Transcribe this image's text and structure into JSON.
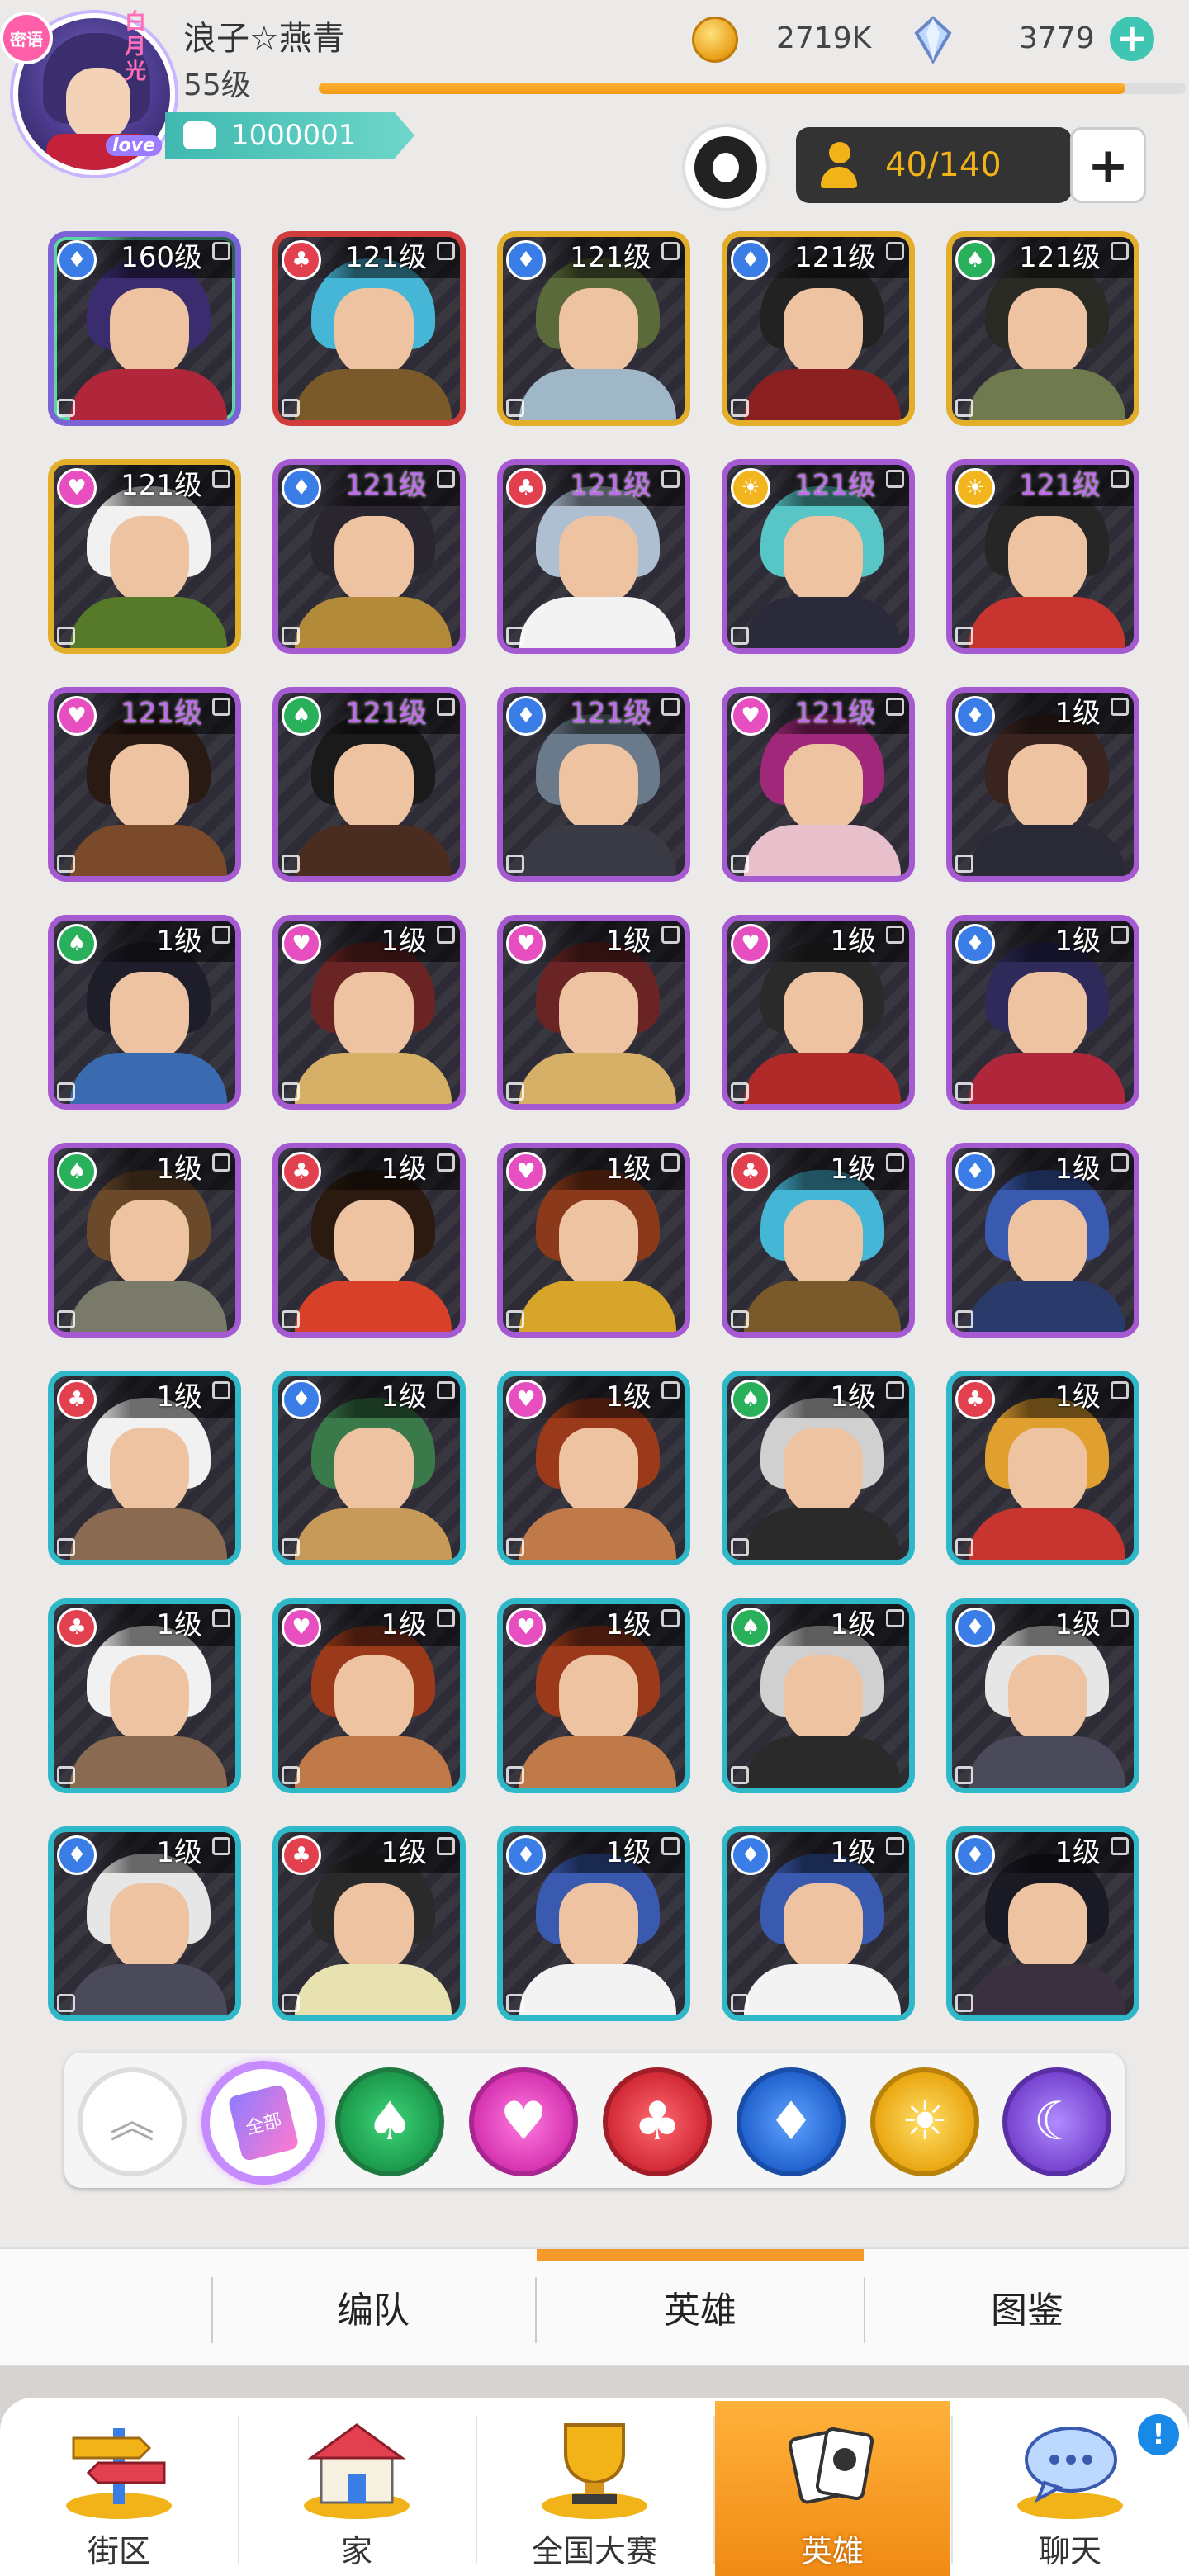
{
  "player": {
    "name": "浪子☆燕青",
    "level": "55级",
    "power": "1000001",
    "xp_fraction": 0.93,
    "avatar_badge": "密语",
    "avatar_deco": "白月光",
    "avatar_love": "love"
  },
  "currency": {
    "gold": "2719K",
    "gems": "3779"
  },
  "roster": {
    "count": "40/140"
  },
  "heroes": [
    {
      "level": "160级",
      "suit": "diamond",
      "quality": "rainbow",
      "hair": "#3a2c6e",
      "body": "#b0263a"
    },
    {
      "level": "121级",
      "suit": "club",
      "quality": "red",
      "hair": "#46b6d6",
      "body": "#7a5a2a"
    },
    {
      "level": "121级",
      "suit": "diamond",
      "quality": "gold",
      "hair": "#5b6a3a",
      "body": "#9fb7c6"
    },
    {
      "level": "121级",
      "suit": "diamond",
      "quality": "gold",
      "hair": "#222222",
      "body": "#8a2020"
    },
    {
      "level": "121级",
      "suit": "spade",
      "quality": "gold",
      "hair": "#2a2a24",
      "body": "#6f7b4f"
    },
    {
      "level": "121级",
      "suit": "heart",
      "quality": "gold",
      "hair": "#f1f1f1",
      "body": "#567a2a"
    },
    {
      "level": "121级",
      "suit": "diamond",
      "quality": "purple",
      "hair": "#2a2630",
      "body": "#b28a3a"
    },
    {
      "level": "121级",
      "suit": "club",
      "quality": "purple",
      "hair": "#aebfd2",
      "body": "#f3f3f3"
    },
    {
      "level": "121级",
      "suit": "sun",
      "quality": "purple",
      "hair": "#58c6c6",
      "body": "#2a2a3a"
    },
    {
      "level": "121级",
      "suit": "sun",
      "quality": "purple",
      "hair": "#262626",
      "body": "#c8342f"
    },
    {
      "level": "121级",
      "suit": "heart",
      "quality": "purple",
      "hair": "#2a1a14",
      "body": "#7a4a2a"
    },
    {
      "level": "121级",
      "suit": "spade",
      "quality": "purple",
      "hair": "#1a1a1a",
      "body": "#4a2c20"
    },
    {
      "level": "121级",
      "suit": "diamond",
      "quality": "purple",
      "hair": "#6a7a8a",
      "body": "#3a3a44"
    },
    {
      "level": "121级",
      "suit": "heart",
      "quality": "purple",
      "hair": "#a0287a",
      "body": "#e8c0cc"
    },
    {
      "level": "1级",
      "suit": "diamond",
      "quality": "purple",
      "hair": "#3a2420",
      "body": "#2a2a36"
    },
    {
      "level": "1级",
      "suit": "spade",
      "quality": "purple",
      "hair": "#1e1e2a",
      "body": "#3a6ab0"
    },
    {
      "level": "1级",
      "suit": "heart",
      "quality": "purple",
      "hair": "#6a2424",
      "body": "#d6b066"
    },
    {
      "level": "1级",
      "suit": "heart",
      "quality": "purple",
      "hair": "#6a2424",
      "body": "#d6b066"
    },
    {
      "level": "1级",
      "suit": "heart",
      "quality": "purple",
      "hair": "#2a2a2a",
      "body": "#b02a2a"
    },
    {
      "level": "1级",
      "suit": "diamond",
      "quality": "purple",
      "hair": "#2e2a5a",
      "body": "#b0263a"
    },
    {
      "level": "1级",
      "suit": "spade",
      "quality": "purple",
      "hair": "#6a4a2a",
      "body": "#7a7a6a"
    },
    {
      "level": "1级",
      "suit": "club",
      "quality": "purple",
      "hair": "#2a1a10",
      "body": "#d8402a"
    },
    {
      "level": "1级",
      "suit": "heart",
      "quality": "purple",
      "hair": "#8a3a1a",
      "body": "#d6a52a"
    },
    {
      "level": "1级",
      "suit": "club",
      "quality": "purple",
      "hair": "#46b6d6",
      "body": "#7a5a2a"
    },
    {
      "level": "1级",
      "suit": "diamond",
      "quality": "purple",
      "hair": "#3a5ab0",
      "body": "#2a3a6a"
    },
    {
      "level": "1级",
      "suit": "club",
      "quality": "teal",
      "hair": "#f1f1f1",
      "body": "#8a6a50"
    },
    {
      "level": "1级",
      "suit": "diamond",
      "quality": "teal",
      "hair": "#3a7a4a",
      "body": "#c89a5a"
    },
    {
      "level": "1级",
      "suit": "heart",
      "quality": "teal",
      "hair": "#9a3a1a",
      "body": "#c07a4a"
    },
    {
      "level": "1级",
      "suit": "spade",
      "quality": "teal",
      "hair": "#d0d0d0",
      "body": "#2a2a2a"
    },
    {
      "level": "1级",
      "suit": "club",
      "quality": "teal",
      "hair": "#e0a030",
      "body": "#c8342f"
    },
    {
      "level": "1级",
      "suit": "club",
      "quality": "teal",
      "hair": "#f1f1f1",
      "body": "#8a6a50"
    },
    {
      "level": "1级",
      "suit": "heart",
      "quality": "teal",
      "hair": "#9a3a1a",
      "body": "#c07a4a"
    },
    {
      "level": "1级",
      "suit": "heart",
      "quality": "teal",
      "hair": "#9a3a1a",
      "body": "#c07a4a"
    },
    {
      "level": "1级",
      "suit": "spade",
      "quality": "teal",
      "hair": "#d0d0d0",
      "body": "#2a2a2a"
    },
    {
      "level": "1级",
      "suit": "diamond",
      "quality": "teal",
      "hair": "#e6e6e6",
      "body": "#4a4a5a"
    },
    {
      "level": "1级",
      "suit": "diamond",
      "quality": "teal",
      "hair": "#e6e6e6",
      "body": "#4a4a5a"
    },
    {
      "level": "1级",
      "suit": "club",
      "quality": "teal",
      "hair": "#2a2a2a",
      "body": "#e8e2b0"
    },
    {
      "level": "1级",
      "suit": "diamond",
      "quality": "teal",
      "hair": "#3a5ab0",
      "body": "#f3f3f3"
    },
    {
      "level": "1级",
      "suit": "diamond",
      "quality": "teal",
      "hair": "#3a5ab0",
      "body": "#f3f3f3"
    },
    {
      "level": "1级",
      "suit": "diamond",
      "quality": "teal",
      "hair": "#1a1a24",
      "body": "#3a3040"
    }
  ],
  "filters": {
    "all_label": "全部"
  },
  "sub_tabs": [
    "编队",
    "英雄",
    "图鉴"
  ],
  "sub_tabs_active": 1,
  "nav": [
    "街区",
    "家",
    "全国大赛",
    "英雄",
    "聊天"
  ],
  "nav_active": 3,
  "nav_alert": "!",
  "colors": {
    "accent_orange": "#f59a2a",
    "teal": "#3ec6b2",
    "roster_gold": "#f2b318"
  }
}
